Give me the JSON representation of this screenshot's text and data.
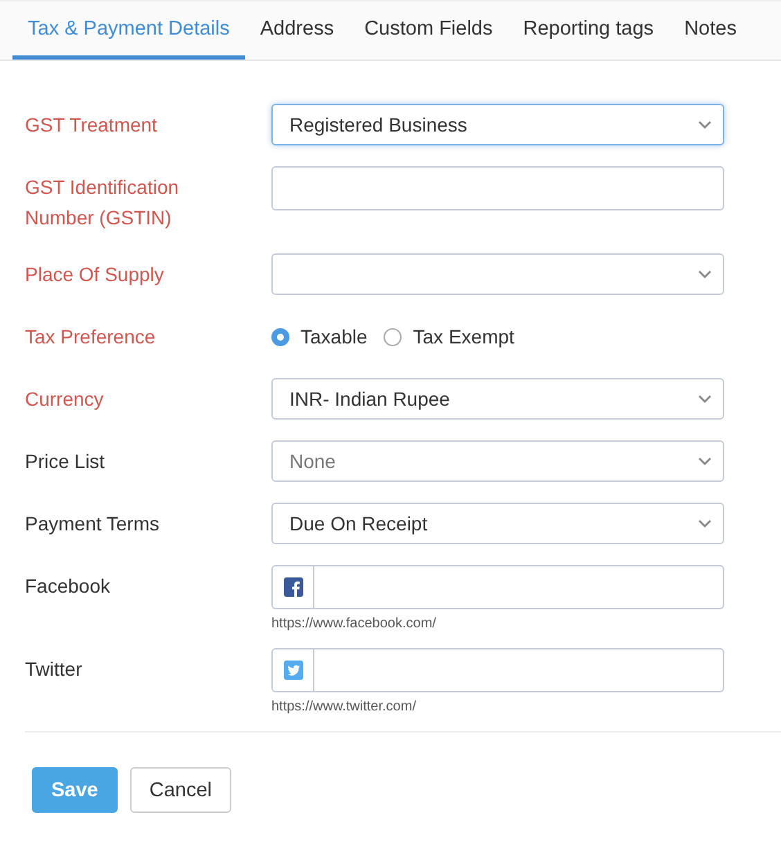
{
  "tabs": [
    {
      "label": "Tax & Payment Details",
      "selected": true
    },
    {
      "label": "Address",
      "selected": false
    },
    {
      "label": "Custom Fields",
      "selected": false
    },
    {
      "label": "Reporting tags",
      "selected": false
    },
    {
      "label": "Notes",
      "selected": false
    }
  ],
  "fields": [
    {
      "kind": "select",
      "label": "GST Treatment",
      "required": true,
      "value": "Registered Business",
      "focused": true
    },
    {
      "kind": "text",
      "label": "GST Identification Number (GSTIN)",
      "required": true
    },
    {
      "kind": "select",
      "label": "Place Of Supply",
      "required": true
    },
    {
      "kind": "radio",
      "label": "Tax Preference",
      "required": true,
      "options": [
        {
          "label": "Taxable",
          "selected": true
        },
        {
          "label": "Tax Exempt",
          "selected": false
        }
      ]
    },
    {
      "kind": "select",
      "label": "Currency",
      "required": true,
      "value": "INR- Indian Rupee"
    },
    {
      "kind": "select",
      "label": "Price List",
      "required": false,
      "placeholder": "None"
    },
    {
      "kind": "select",
      "label": "Payment Terms",
      "required": false,
      "value": "Due On Receipt"
    },
    {
      "kind": "facebook",
      "label": "Facebook",
      "required": false,
      "hint": "https://www.facebook.com/"
    },
    {
      "kind": "twitter",
      "label": "Twitter",
      "required": false,
      "hint": "https://www.twitter.com/"
    }
  ],
  "buttons": [
    {
      "kind": "primary",
      "label": "Save"
    },
    {
      "kind": "secondary",
      "label": "Cancel"
    }
  ]
}
